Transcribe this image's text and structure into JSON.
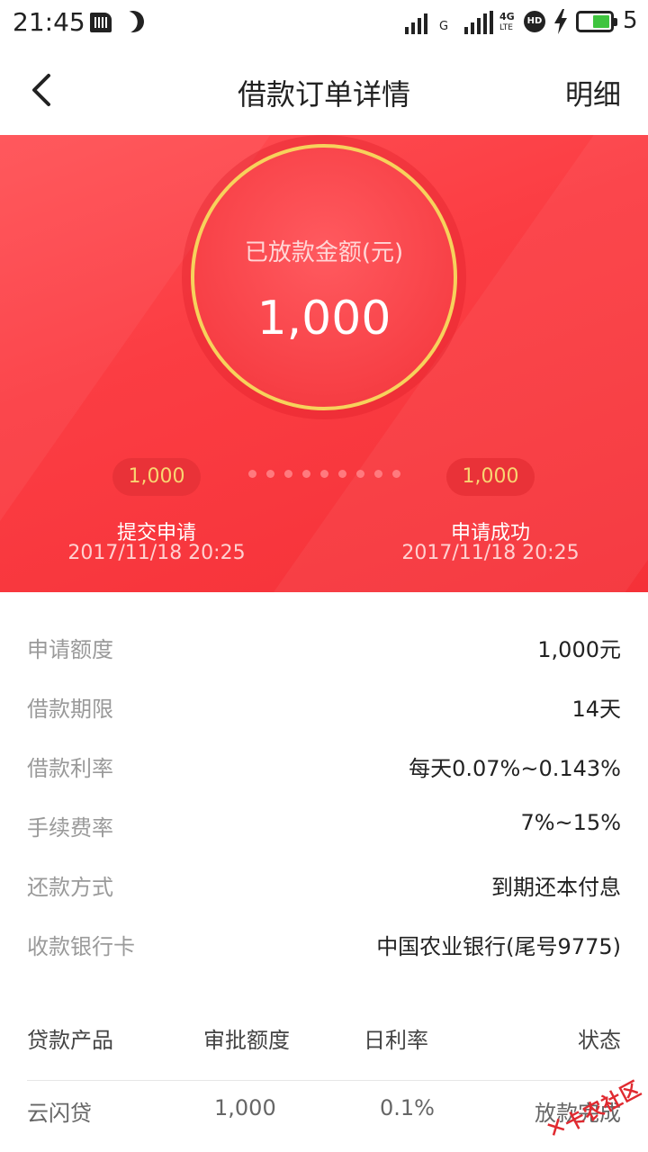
{
  "status_bar": {
    "time": "21:45",
    "net_label_1": "G",
    "net_label_2": "4G",
    "net_label_3": "LTE",
    "hd_label": "HD",
    "battery": "5"
  },
  "header": {
    "title": "借款订单详情",
    "detail_link": "明细"
  },
  "hero": {
    "amount_label": "已放款金额(元)",
    "amount_value": "1,000",
    "steps": [
      {
        "badge": "1,000",
        "title": "提交申请",
        "time": "2017/11/18 20:25"
      },
      {
        "badge": "1,000",
        "title": "申请成功",
        "time": "2017/11/18 20:25"
      }
    ]
  },
  "info": [
    {
      "label": "申请额度",
      "value": "1,000元"
    },
    {
      "label": "借款期限",
      "value": "14天"
    },
    {
      "label": "借款利率",
      "value": "每天0.07%~0.143%"
    },
    {
      "label": "手续费率",
      "value": "7%~15%"
    },
    {
      "label": "还款方式",
      "value": "到期还本付息"
    },
    {
      "label": "收款银行卡",
      "value": "中国农业银行(尾号9775)"
    }
  ],
  "table": {
    "headers": [
      "贷款产品",
      "审批额度",
      "日利率",
      "状态"
    ],
    "rows": [
      [
        "云闪贷",
        "1,000",
        "0.1%",
        "放款完成"
      ]
    ]
  },
  "watermark": {
    "text": "卡农社区"
  },
  "colors": {
    "hero_red": "#fb3d43",
    "ring_gold": "#f7d25c",
    "badge_text": "#f9d572"
  }
}
